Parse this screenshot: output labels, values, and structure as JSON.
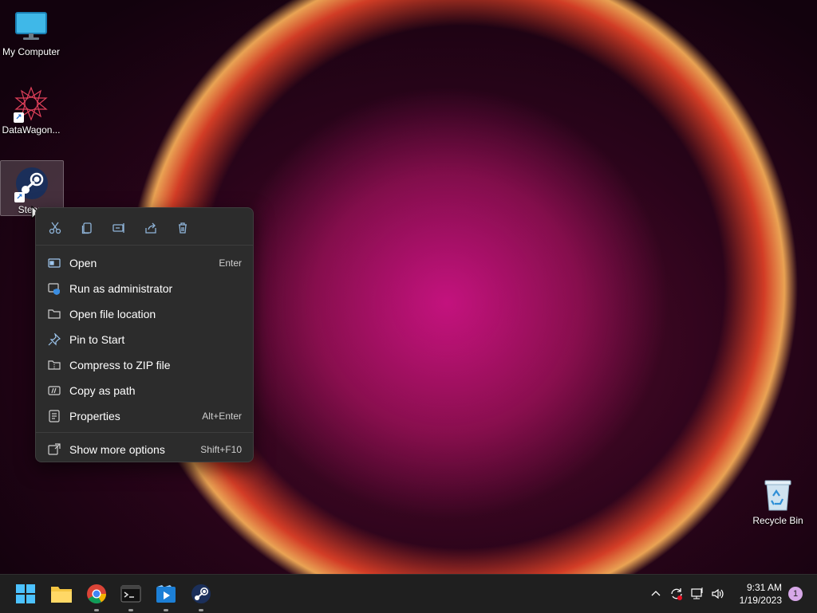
{
  "desktop": {
    "icons": [
      {
        "label": "My Computer"
      },
      {
        "label": "DataWagon..."
      },
      {
        "label": "Steam"
      },
      {
        "label": "Recycle Bin"
      }
    ]
  },
  "context_menu": {
    "toolbar": [
      {
        "icon": "cut-icon"
      },
      {
        "icon": "copy-icon"
      },
      {
        "icon": "rename-icon"
      },
      {
        "icon": "share-icon"
      },
      {
        "icon": "delete-icon"
      }
    ],
    "items": [
      {
        "label": "Open",
        "shortcut": "Enter",
        "icon": "open-icon"
      },
      {
        "label": "Run as administrator",
        "shortcut": "",
        "icon": "shield-icon"
      },
      {
        "label": "Open file location",
        "shortcut": "",
        "icon": "folder-icon"
      },
      {
        "label": "Pin to Start",
        "shortcut": "",
        "icon": "pin-icon"
      },
      {
        "label": "Compress to ZIP file",
        "shortcut": "",
        "icon": "zip-icon"
      },
      {
        "label": "Copy as path",
        "shortcut": "",
        "icon": "path-icon"
      },
      {
        "label": "Properties",
        "shortcut": "Alt+Enter",
        "icon": "properties-icon"
      }
    ],
    "more": {
      "label": "Show more options",
      "shortcut": "Shift+F10",
      "icon": "more-options-icon"
    }
  },
  "taskbar": {
    "apps": [
      {
        "name": "start-button"
      },
      {
        "name": "file-explorer"
      },
      {
        "name": "chrome"
      },
      {
        "name": "terminal"
      },
      {
        "name": "media-player"
      },
      {
        "name": "steam"
      }
    ],
    "clock": {
      "time": "9:31 AM",
      "date": "1/19/2023"
    },
    "notifications": "1"
  }
}
